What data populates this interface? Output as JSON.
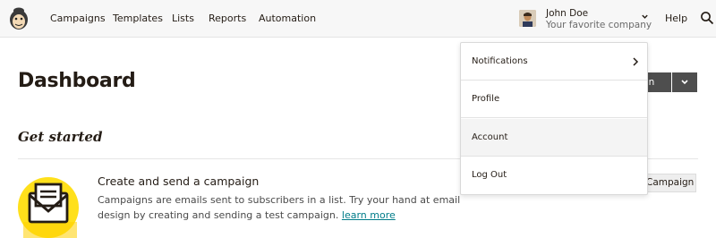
{
  "topbar": {
    "nav": [
      "Campaigns",
      "Templates",
      "Lists",
      "Reports",
      "Automation"
    ],
    "user": {
      "name": "John Doe",
      "company": "Your favorite company"
    },
    "help_label": "Help",
    "icons": {
      "logo": "freddie-logo",
      "search": "search-icon",
      "chevron": "chevron-down-icon"
    }
  },
  "main": {
    "page_title": "Dashboard",
    "create_button_label": "gn",
    "section_title": "Get started",
    "card": {
      "title": "Create and send a campaign",
      "description": "Campaigns are emails sent to subscribers in a list. Try your hand at email design by creating and sending a test campaign.",
      "link": "learn more",
      "button_label": "Campaign"
    }
  },
  "dropdown": {
    "items": [
      {
        "label": "Notifications"
      },
      {
        "label": "Profile"
      },
      {
        "label": "Account"
      },
      {
        "label": "Log Out"
      }
    ]
  },
  "colors": {
    "accent_link": "#007c89",
    "dark_button": "#4e4e4e",
    "envelope_yellow": "#ffe01b",
    "topbar_bg": "#f7f7f7"
  }
}
